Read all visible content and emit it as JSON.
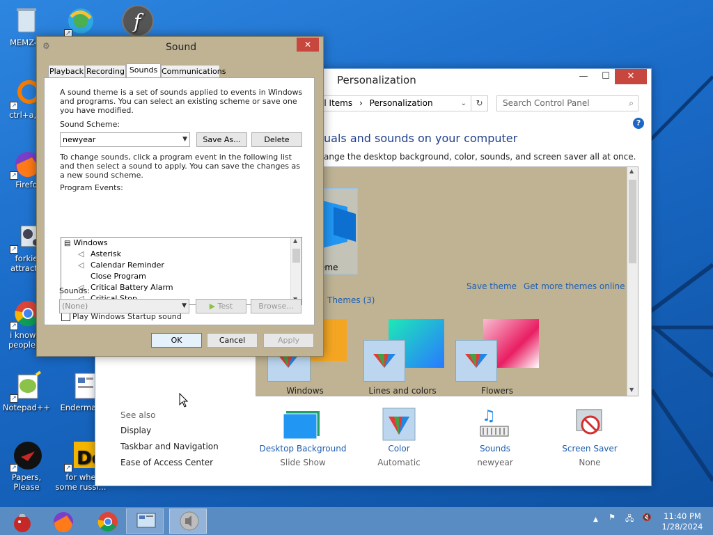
{
  "desktop": {
    "icons": [
      {
        "name": "recycle-bin-icon",
        "label": "MEMZ-D"
      },
      {
        "name": "edge-shortcut-icon",
        "label": ""
      },
      {
        "name": "flash-player-icon",
        "label": ""
      },
      {
        "name": "ctrl-a-shortcut-icon",
        "label": "ctrl+a, e"
      },
      {
        "name": "firefox-shortcut-icon",
        "label": "Firefo"
      },
      {
        "name": "forkie-shortcut-icon",
        "label": "forkie attracta"
      },
      {
        "name": "chrome-shortcut-icon",
        "label": "i know y people w"
      },
      {
        "name": "notepadpp-shortcut-icon",
        "label": "Notepad++"
      },
      {
        "name": "enderman-shortcut-icon",
        "label": "Enderman"
      },
      {
        "name": "papers-please-shortcut-icon",
        "label": "Papers, Please"
      },
      {
        "name": "russian-shortcut-icon",
        "label": "for whe some russi..."
      }
    ]
  },
  "personalization": {
    "title": "Personalization",
    "window_buttons": {
      "minimize": "—",
      "maximize": "☐",
      "close": "✕"
    },
    "breadcrumb": [
      "el Items",
      "Personalization"
    ],
    "breadcrumb_sep": "›",
    "search_placeholder": "Search Control Panel",
    "heading": "uals and sounds on your computer",
    "subheading": "ange the desktop background, color, sounds, and screen saver all at once.",
    "partial_theme_label": "eme",
    "save_theme": "Save theme",
    "get_more": "Get more themes online",
    "themes_group": "Themes (3)",
    "themes": [
      "Windows",
      "Lines and colors",
      "Flowers"
    ],
    "bottom_items": [
      {
        "label": "Desktop Background",
        "sub": "Slide Show"
      },
      {
        "label": "Color",
        "sub": "Automatic"
      },
      {
        "label": "Sounds",
        "sub": "newyear"
      },
      {
        "label": "Screen Saver",
        "sub": "None"
      }
    ],
    "see_also": "See also",
    "see_also_links": [
      "Display",
      "Taskbar and Navigation",
      "Ease of Access Center"
    ]
  },
  "sound_dialog": {
    "title": "Sound",
    "close": "✕",
    "tabs": [
      "Playback",
      "Recording",
      "Sounds",
      "Communications"
    ],
    "active_tab": "Sounds",
    "intro": "A sound theme is a set of sounds applied to events in Windows and programs.  You can select an existing scheme or save one you have modified.",
    "scheme_label": "Sound Scheme:",
    "scheme_value": "newyear",
    "save_as": "Save As...",
    "delete": "Delete",
    "instructions": "To change sounds, click a program event in the following list and then select a sound to apply.  You can save the changes as a new sound scheme.",
    "events_label": "Program Events:",
    "events": [
      {
        "label": "Windows",
        "root": true
      },
      {
        "label": "Asterisk",
        "sound": true
      },
      {
        "label": "Calendar Reminder",
        "sound": true
      },
      {
        "label": "Close Program",
        "sound": false
      },
      {
        "label": "Critical Battery Alarm",
        "sound": true
      },
      {
        "label": "Critical Stop",
        "sound": true
      }
    ],
    "startup_label": "Play Windows Startup sound",
    "sounds_label": "Sounds:",
    "sounds_value": "(None)",
    "test": "Test",
    "browse": "Browse...",
    "ok": "OK",
    "cancel": "Cancel",
    "apply": "Apply"
  },
  "taskbar": {
    "time": "11:40 PM",
    "date": "1/28/2024"
  },
  "colors": {
    "accent": "#1e5eb0",
    "close_red": "#c7463d",
    "dialog_frame": "#bfb394"
  }
}
